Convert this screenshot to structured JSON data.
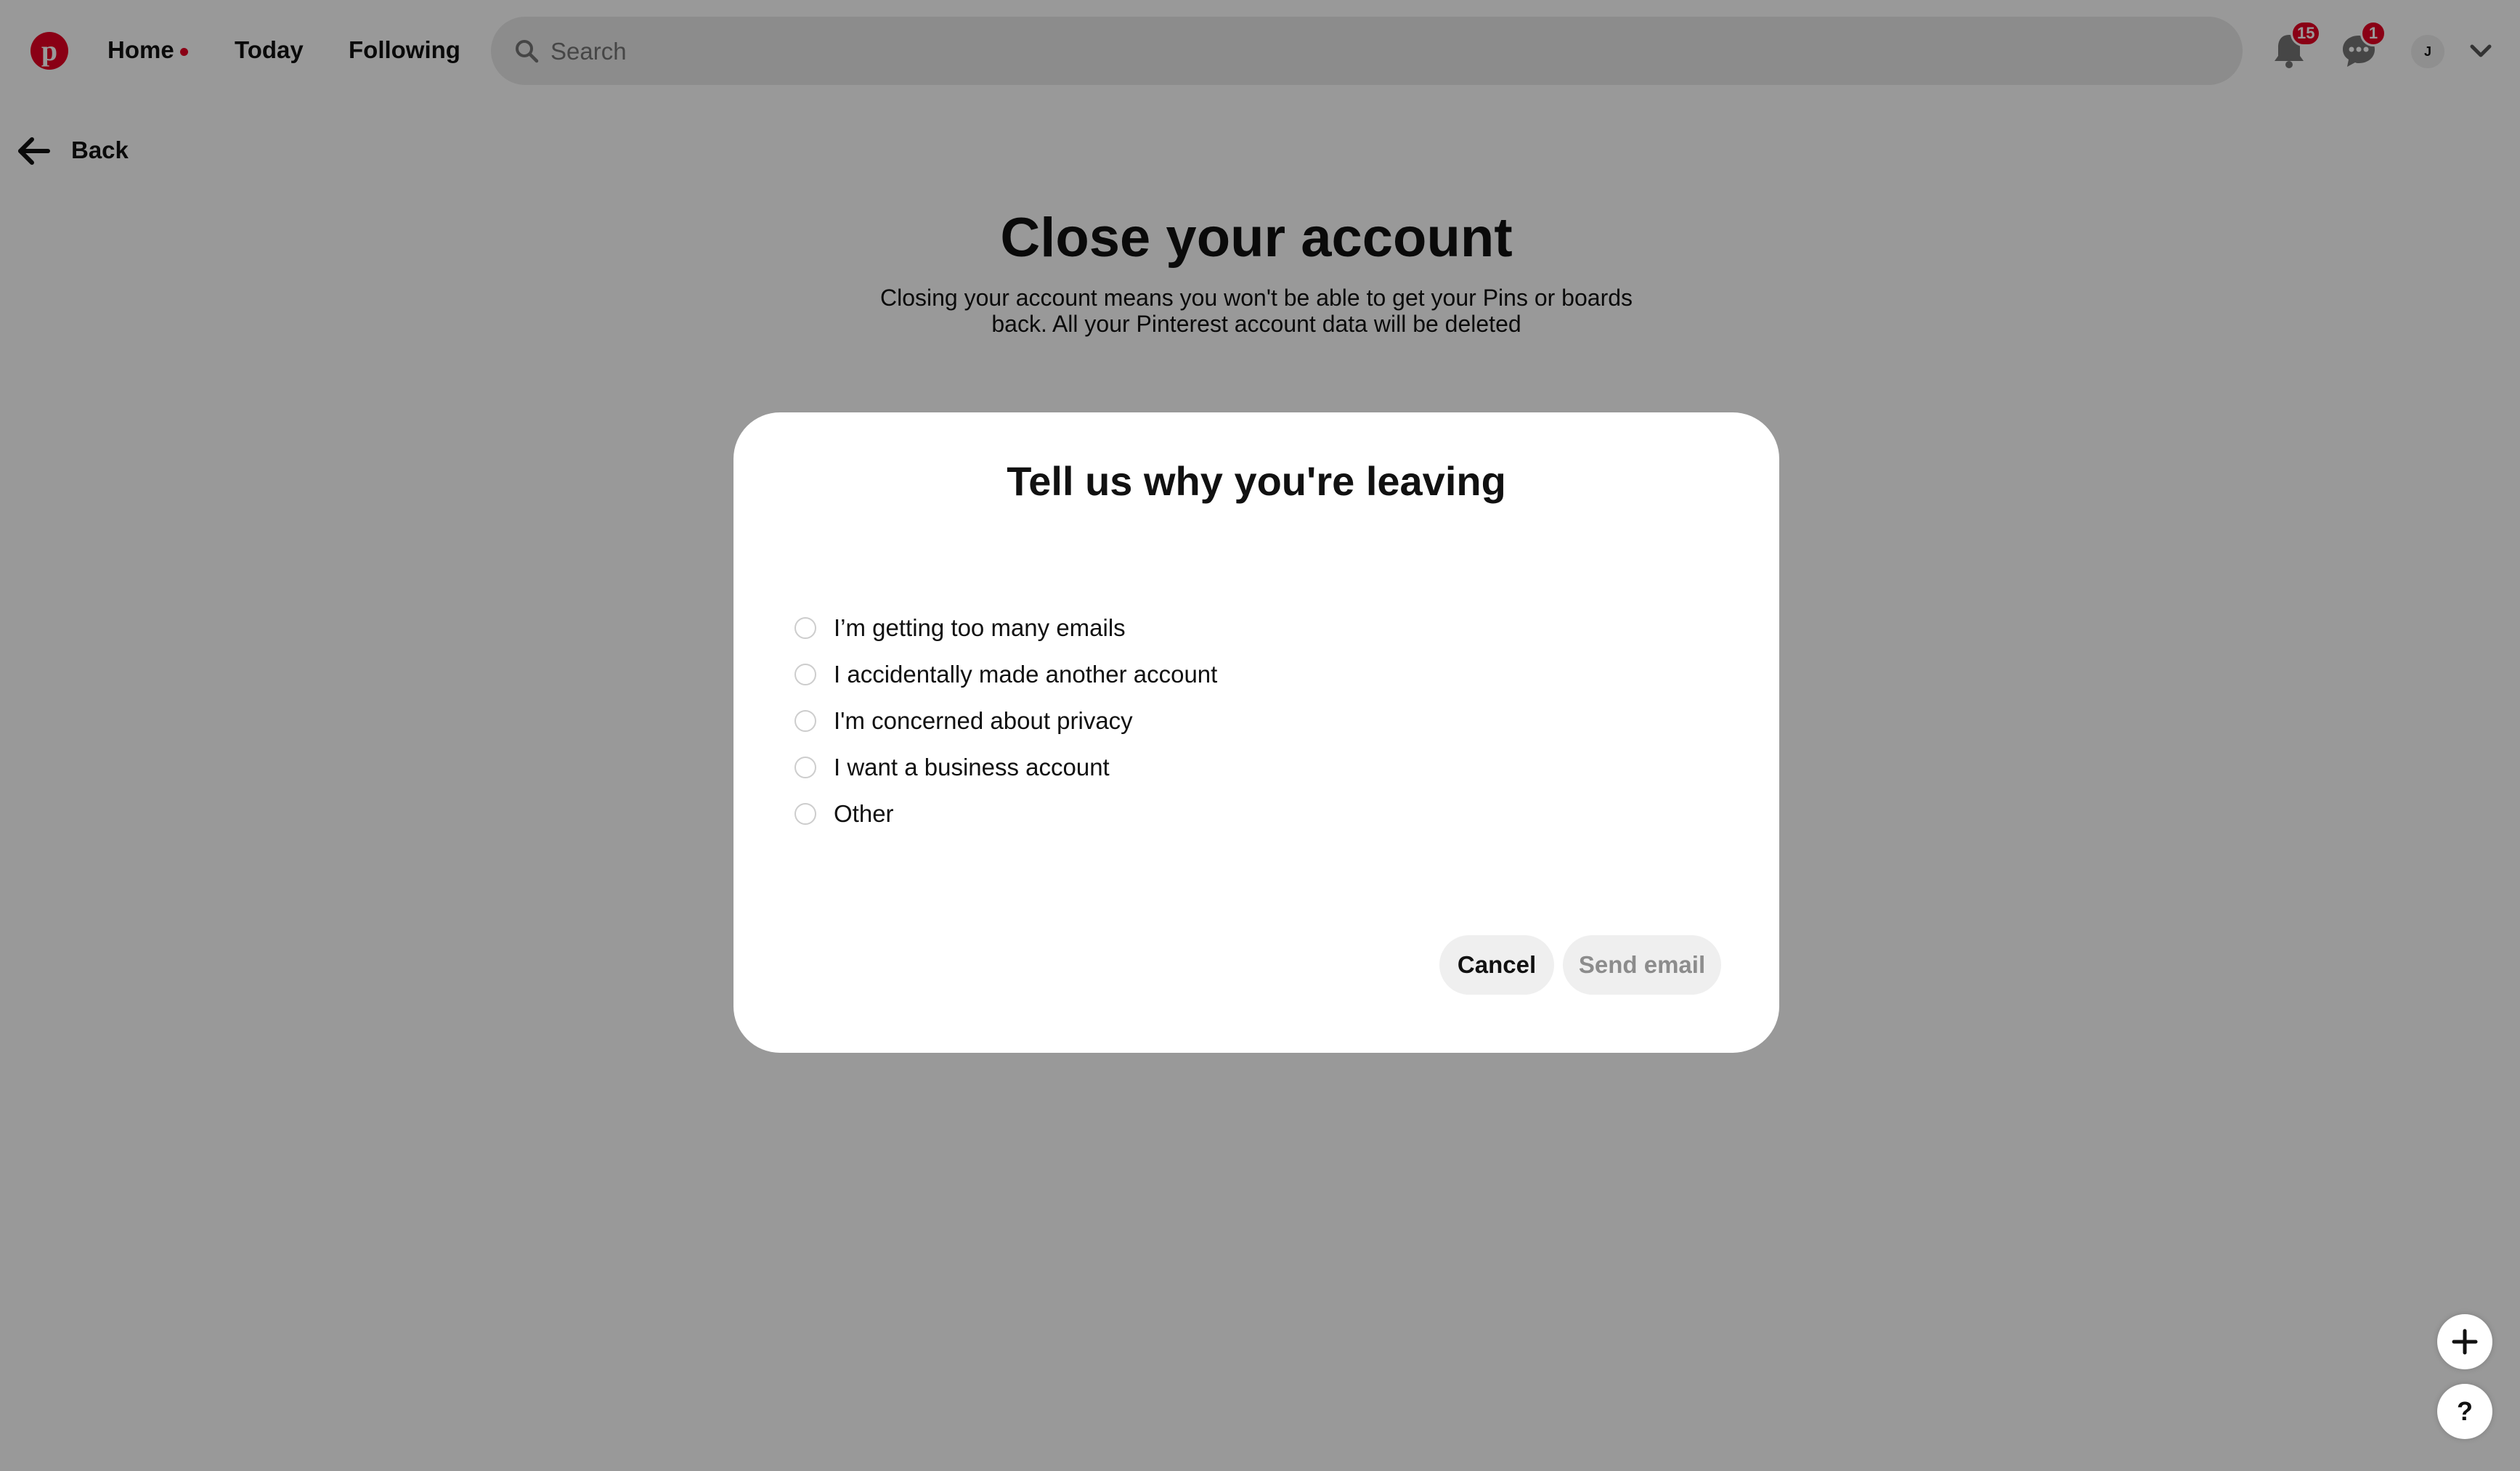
{
  "header": {
    "logo_icon": "pinterest-logo-icon",
    "nav": [
      {
        "label": "Home"
      },
      {
        "label": "Today"
      },
      {
        "label": "Following"
      }
    ],
    "search": {
      "placeholder": "Search",
      "value": ""
    },
    "notifications": {
      "icon": "bell-icon",
      "badge": "15"
    },
    "messages": {
      "icon": "chat-icon",
      "badge": "1"
    },
    "avatar_initial": "J",
    "account_menu_icon": "chevron-down-icon"
  },
  "page": {
    "back_label": "Back",
    "title": "Close your account",
    "description": "Closing your account means you won't be able to get your Pins or boards back. All your Pinterest account data will be deleted"
  },
  "modal": {
    "title": "Tell us why you're leaving",
    "options": [
      {
        "label": "I’m getting too many emails",
        "selected": false
      },
      {
        "label": "I accidentally made another account",
        "selected": false
      },
      {
        "label": "I'm concerned about privacy",
        "selected": false
      },
      {
        "label": "I want a business account",
        "selected": false
      },
      {
        "label": "Other",
        "selected": false
      }
    ],
    "cancel_label": "Cancel",
    "send_label": "Send email"
  },
  "floating": {
    "add_icon": "plus-icon",
    "help_label": "?"
  },
  "colors": {
    "brand": "#e60023",
    "overlay": "rgba(0,0,0,0.40)",
    "button_bg": "#efefef"
  }
}
